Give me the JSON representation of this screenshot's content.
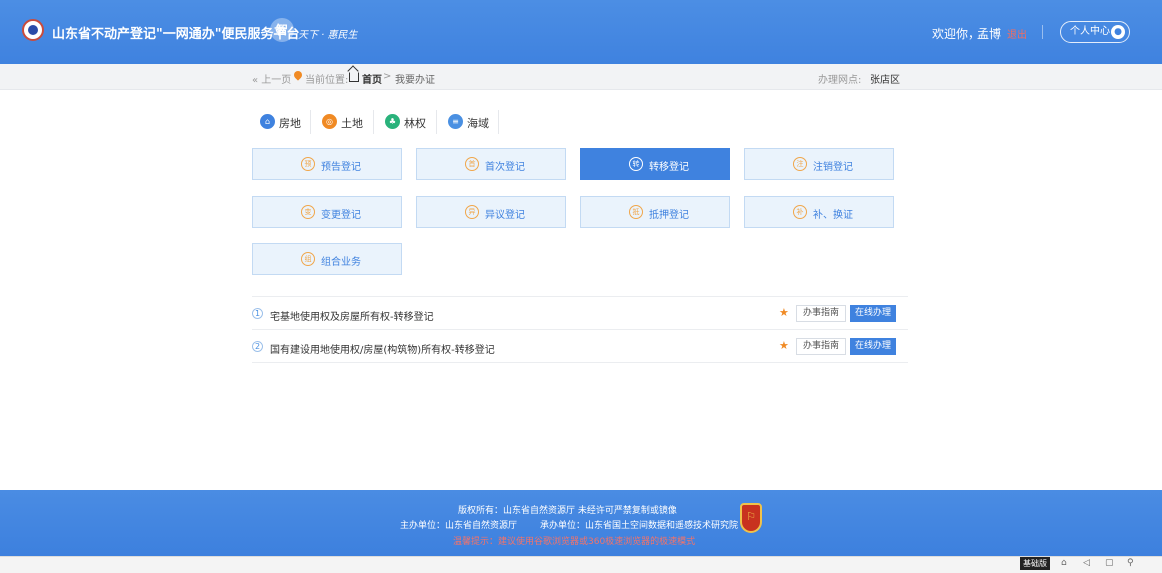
{
  "header": {
    "site_title": "山东省不动产登记\"一网通办\"便民服务平台",
    "slogan_mark": "智",
    "slogan_text": "天下 · 惠民生",
    "welcome": "欢迎你，",
    "user_name": "孟博",
    "logout": "退出",
    "user_center": "个人中心",
    "user_center_icon": "user-circle-icon"
  },
  "breadcrumb": {
    "back": "« 上一页",
    "location_label": "当前位置:",
    "home": "首页",
    "separator": ">",
    "current": "我要办证",
    "office_label": "办理网点:",
    "office_value": "张店区"
  },
  "categories": [
    {
      "label": "房地",
      "icon": "house-icon",
      "color": "#3f82df",
      "glyph": "⌂"
    },
    {
      "label": "土地",
      "icon": "land-icon",
      "color": "#f08a24",
      "glyph": "◎"
    },
    {
      "label": "林权",
      "icon": "tree-icon",
      "color": "#2ab27b",
      "glyph": "♣"
    },
    {
      "label": "海域",
      "icon": "sea-icon",
      "color": "#4a90e2",
      "glyph": "≡"
    }
  ],
  "businesses": [
    {
      "label": "预告登记",
      "glyph": "预"
    },
    {
      "label": "首次登记",
      "glyph": "首"
    },
    {
      "label": "转移登记",
      "glyph": "转",
      "active": true
    },
    {
      "label": "注销登记",
      "glyph": "注"
    },
    {
      "label": "变更登记",
      "glyph": "变"
    },
    {
      "label": "异议登记",
      "glyph": "异"
    },
    {
      "label": "抵押登记",
      "glyph": "抵"
    },
    {
      "label": "补、换证",
      "glyph": "补"
    },
    {
      "label": "组合业务",
      "glyph": "组"
    }
  ],
  "items": [
    {
      "num": "1",
      "title": "宅基地使用权及房屋所有权-转移登记",
      "star": "★",
      "guide": "办事指南",
      "online": "在线办理"
    },
    {
      "num": "2",
      "title": "国有建设用地使用权/房屋(构筑物)所有权-转移登记",
      "star": "★",
      "guide": "办事指南",
      "online": "在线办理"
    }
  ],
  "footer": {
    "copyright": "版权所有：山东省自然资源厅 未经许可严禁复制或镜像",
    "host": "主办单位：山东省自然资源厅",
    "undertaker": "承办单位：山东省国土空间数据和遥感技术研究院",
    "tip": "温馨提示：建议使用谷歌浏览器或360极速浏览器的极速模式",
    "emblem_glyph": "⚐"
  },
  "tools": {
    "badge": "基础版",
    "icons": [
      "⌂",
      "◁",
      "▢",
      "⚲"
    ]
  },
  "colors": {
    "brand": "#3f82df",
    "accent": "#f08a24",
    "warning": "#f3736a"
  }
}
